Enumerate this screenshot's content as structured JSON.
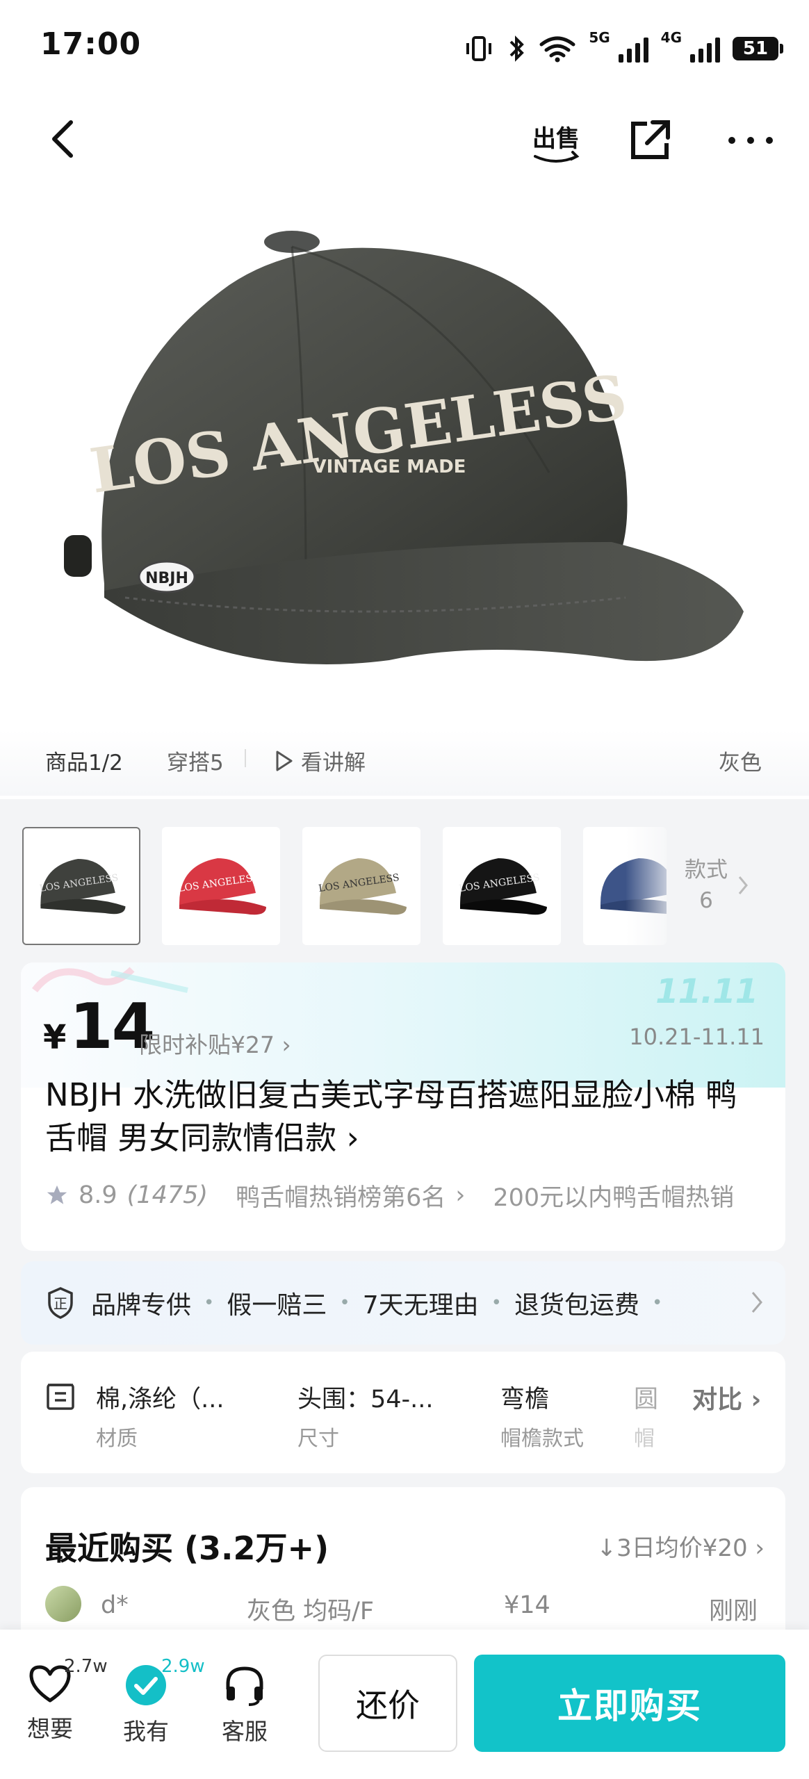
{
  "status_bar": {
    "time": "17:00",
    "net1": "5G",
    "net2": "4G",
    "battery": "51"
  },
  "header": {
    "back_icon": "chevron-left-icon",
    "sell_label": "出售",
    "share_icon": "share-icon",
    "more_icon": "more-icon"
  },
  "product_image": {
    "text_line1": "LOS ANGELESS",
    "text_line2": "VINTAGE MADE",
    "badge": "NBJH"
  },
  "media_tabs": {
    "product": "商品1/2",
    "outfit": "穿搭5",
    "explain": "看讲解",
    "color": "灰色"
  },
  "variants": {
    "colors": [
      "#3f413d",
      "#d93844",
      "#b2a886",
      "#151515",
      "#3d5488"
    ],
    "more_label": "款式",
    "more_count": "6"
  },
  "price": {
    "currency": "¥",
    "amount": "14",
    "subsidy": "限时补贴¥27",
    "festival": "11.11",
    "date_range": "10.21-11.11"
  },
  "title": "NBJH 水洗做旧复古美式字母百搭遮阳显脸小棉 鸭舌帽 男女同款情侣款",
  "rating": {
    "score": "8.9",
    "count": "(1475)",
    "rank1": "鸭舌帽热销榜第6名",
    "rank2": "200元以内鸭舌帽热销"
  },
  "guarantees": [
    "品牌专供",
    "假一赔三",
    "7天无理由",
    "退货包运费"
  ],
  "specs": [
    {
      "value": "棉,涤纶（...",
      "key": "材质"
    },
    {
      "value": "头围：54-...",
      "key": "尺寸"
    },
    {
      "value": "弯檐",
      "key": "帽檐款式"
    },
    {
      "value": "圆",
      "key": "帽"
    }
  ],
  "compare_label": "对比",
  "recent": {
    "title": "最近购买 (3.2万+)",
    "avg_price": "↓3日均价¥20",
    "row": {
      "user": "d*",
      "spec": "灰色 均码/F",
      "price": "¥14",
      "time": "刚刚"
    }
  },
  "bottom_bar": {
    "want": {
      "label": "想要",
      "count": "2.7w"
    },
    "have": {
      "label": "我有",
      "count": "2.9w"
    },
    "service": {
      "label": "客服"
    },
    "counter_offer": "还价",
    "buy_now": "立即购买"
  }
}
